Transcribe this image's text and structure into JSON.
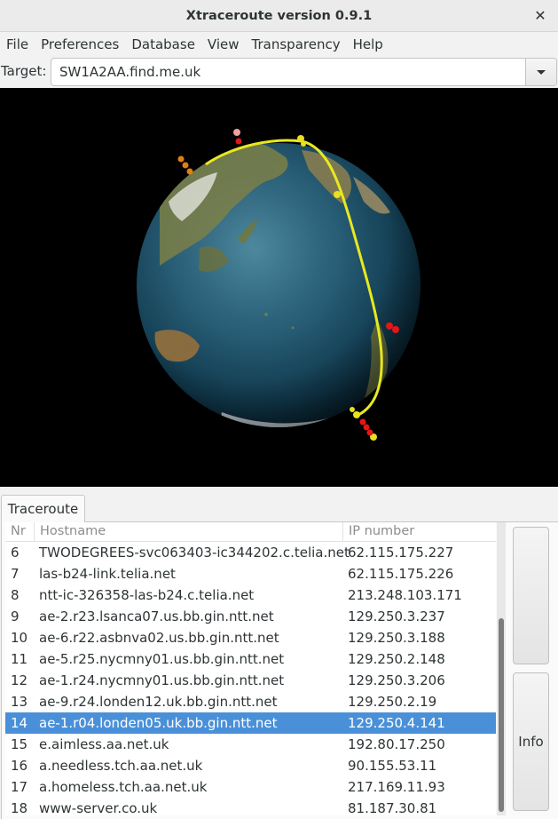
{
  "window": {
    "title": "Xtraceroute version 0.9.1",
    "close_glyph": "✕"
  },
  "menu": [
    "File",
    "Preferences",
    "Database",
    "View",
    "Transparency",
    "Help"
  ],
  "target": {
    "label": "Target:",
    "value": "SW1A2AA.find.me.uk"
  },
  "tabs": {
    "traceroute": "Traceroute"
  },
  "table": {
    "headers": {
      "nr": "Nr",
      "hostname": "Hostname",
      "ip": "IP number"
    },
    "rows": [
      {
        "nr": "6",
        "hostname": "TWODEGREES-svc063403-ic344202.c.telia.net",
        "ip": "62.115.175.227"
      },
      {
        "nr": "7",
        "hostname": "las-b24-link.telia.net",
        "ip": "62.115.175.226"
      },
      {
        "nr": "8",
        "hostname": "ntt-ic-326358-las-b24.c.telia.net",
        "ip": "213.248.103.171"
      },
      {
        "nr": "9",
        "hostname": "ae-2.r23.lsanca07.us.bb.gin.ntt.net",
        "ip": "129.250.3.237"
      },
      {
        "nr": "10",
        "hostname": "ae-6.r22.asbnva02.us.bb.gin.ntt.net",
        "ip": "129.250.3.188"
      },
      {
        "nr": "11",
        "hostname": "ae-5.r25.nycmny01.us.bb.gin.ntt.net",
        "ip": "129.250.2.148"
      },
      {
        "nr": "12",
        "hostname": "ae-1.r24.nycmny01.us.bb.gin.ntt.net",
        "ip": "129.250.3.206"
      },
      {
        "nr": "13",
        "hostname": "ae-9.r24.londen12.uk.bb.gin.ntt.net",
        "ip": "129.250.2.19"
      },
      {
        "nr": "14",
        "hostname": "ae-1.r04.londen05.uk.bb.gin.ntt.net",
        "ip": "129.250.4.141"
      },
      {
        "nr": "15",
        "hostname": "e.aimless.aa.net.uk",
        "ip": "192.80.17.250"
      },
      {
        "nr": "16",
        "hostname": "a.needless.tch.aa.net.uk",
        "ip": "90.155.53.11"
      },
      {
        "nr": "17",
        "hostname": "a.homeless.tch.aa.net.uk",
        "ip": "217.169.11.93"
      },
      {
        "nr": "18",
        "hostname": "www-server.co.uk",
        "ip": "81.187.30.81"
      }
    ],
    "selected_nr": "14"
  },
  "buttons": {
    "info": "Info"
  },
  "colors": {
    "selection": "#4a90d9",
    "route_line": "#e8e820",
    "router_marker": "#e8e020",
    "host_marker": "#e01818"
  }
}
